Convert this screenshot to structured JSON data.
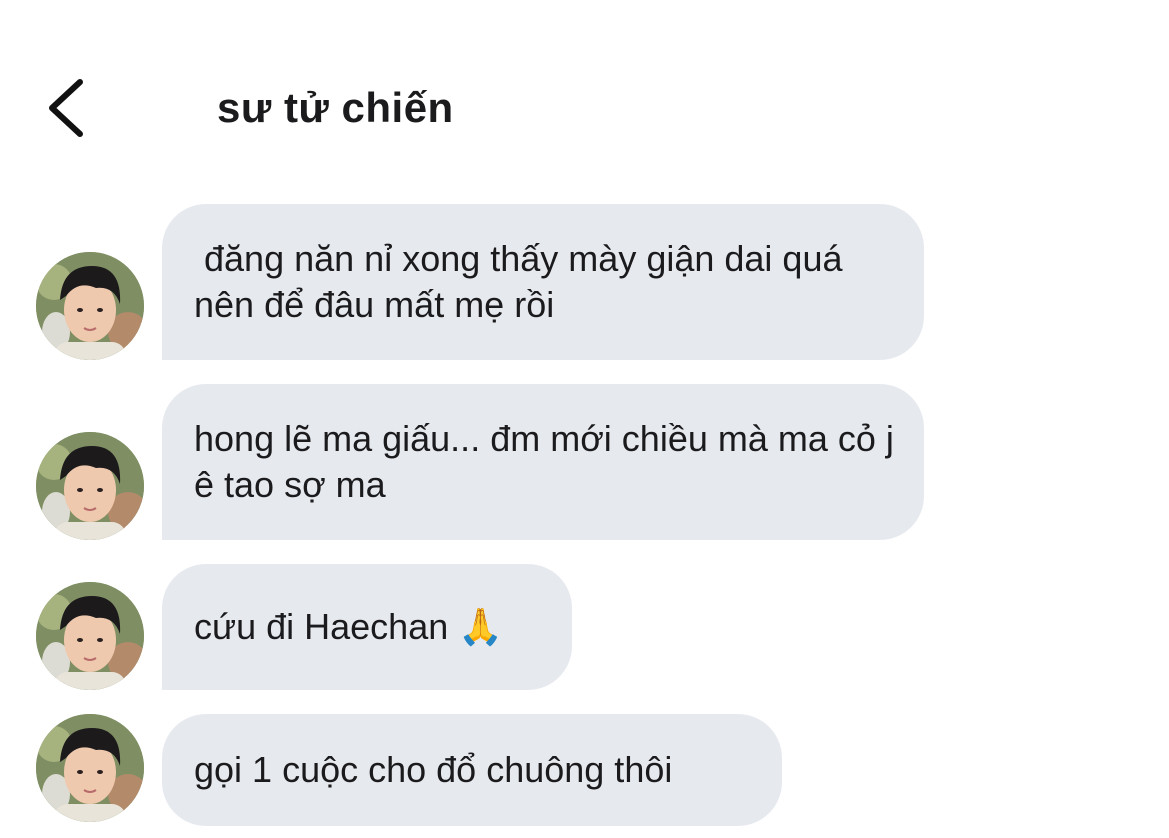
{
  "header": {
    "back_icon": "chevron-left-icon",
    "title": "sư tử chiến"
  },
  "messages": [
    {
      "text": " đăng năn nỉ xong thấy mày giận dai quá nên để đâu mất mẹ rồi"
    },
    {
      "text": "hong lẽ ma giấu... đm mới chiều mà ma cỏ j ê tao sợ ma"
    },
    {
      "text": "cứu đi Haechan 🙏"
    },
    {
      "text": "gọi 1 cuộc cho đổ chuông thôi"
    }
  ],
  "colors": {
    "bubble_bg": "#e6e9ee",
    "text": "#1b1b1d",
    "background": "#ffffff"
  }
}
